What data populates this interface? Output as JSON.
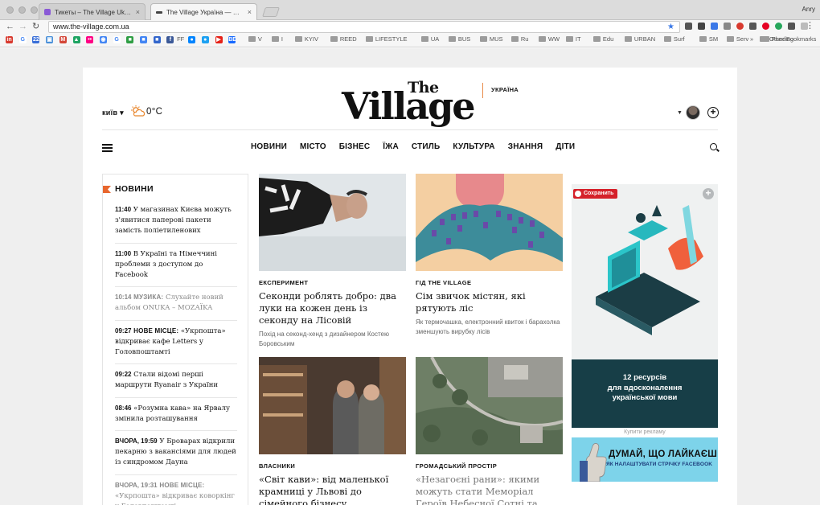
{
  "browser": {
    "tabs": [
      {
        "label": "Тикеты – The Village Ukraine",
        "active": false
      },
      {
        "label": "The Village Україна — Новини",
        "active": true
      }
    ],
    "user_name": "Anry",
    "url": "www.the-village.com.ua",
    "bookmark_folders": [
      "V",
      "I",
      "KYIV",
      "REED",
      "LIFESTYLE",
      "UA",
      "BUS",
      "MUS",
      "Ru",
      "WW",
      "IT",
      "Edu",
      "URBAN",
      "Surf",
      "SM",
      "Serv",
      "Funding"
    ],
    "other_bookmarks": "Other Bookmarks",
    "bookmark_icons": [
      {
        "text": "in",
        "color": "#d83a2f"
      },
      {
        "text": "G",
        "color": "#ffffff"
      },
      {
        "text": "22",
        "color": "#3a6fd8"
      },
      {
        "text": "▣",
        "color": "#4a90d9"
      },
      {
        "text": "M",
        "color": "#d44638"
      },
      {
        "text": "▲",
        "color": "#1fa463"
      },
      {
        "text": "••",
        "color": "#ff0084"
      },
      {
        "text": "◉",
        "color": "#4285f4"
      },
      {
        "text": "G",
        "color": "#ffffff"
      },
      {
        "text": "■",
        "color": "#2f9e44"
      },
      {
        "text": "■",
        "color": "#4285f4"
      },
      {
        "text": "■",
        "color": "#3366cc"
      },
      {
        "text": "f",
        "color": "#3b5998"
      }
    ],
    "bookmark_ff": "FF",
    "bookmark_icons2": [
      {
        "text": "●",
        "color": "#0084ff"
      },
      {
        "text": "●",
        "color": "#1da1f2"
      },
      {
        "text": "▶",
        "color": "#e62117"
      },
      {
        "text": "BЕ",
        "color": "#1769ff"
      }
    ],
    "extension_colors": [
      "#555555",
      "#444444",
      "#3b78e7",
      "#888888",
      "#d83a2f",
      "#555555",
      "#e60023",
      "#26a65b",
      "#555555",
      "#bbbbbb"
    ]
  },
  "site": {
    "city": "київ",
    "temperature": "0°C",
    "logo_the": "The",
    "logo_main": "Village",
    "region": "УКРАЇНА",
    "nav": [
      "НОВИНИ",
      "МІСТО",
      "БІЗНЕС",
      "ЇЖА",
      "СТИЛЬ",
      "КУЛЬТУРА",
      "ЗНАННЯ",
      "ДІТИ"
    ],
    "accent_color": "#e8662d"
  },
  "news": {
    "title": "НОВИНИ",
    "items": [
      {
        "time": "11:40",
        "tag": "",
        "text": "У магазинах Києва можуть з'явитися паперові пакети замість поліетиленових",
        "dim": false
      },
      {
        "time": "11:00",
        "tag": "",
        "text": "В Україні та Німеччині проблеми з доступом до Facebook",
        "dim": false
      },
      {
        "time": "10:14",
        "tag": "МУЗИКА:",
        "text": "Слухайте новий альбом ONUKA – MOZAЇKA",
        "dim": true
      },
      {
        "time": "09:27",
        "tag": "НОВЕ МІСЦЕ:",
        "text": "«Укрпошта» відкриває кафе Letters у Головпоштамті",
        "dim": false
      },
      {
        "time": "09:22",
        "tag": "",
        "text": "Стали відомі перші маршрути Ryanair з України",
        "dim": false
      },
      {
        "time": "08:46",
        "tag": "",
        "text": "«Розумна кава» на Ярвалу змінила розташування",
        "dim": false
      },
      {
        "time": "ВЧОРА, 19:59",
        "tag": "",
        "text": "У Броварах відкрили пекарню з вакансіями для людей із синдромом Дауна",
        "dim": false
      },
      {
        "time": "ВЧОРА, 19:31",
        "tag": "НОВЕ МІСЦЕ:",
        "text": "«Укрпошта» відкриває коворкінг у Головпоштамті",
        "dim": true
      }
    ]
  },
  "articles": [
    {
      "rubric": "ЕКСПЕРИМЕНТ",
      "headline": "Секонди роблять добро: два луки на кожен день із секонду на Лісовій",
      "lead": "Похід на секонд-хенд з дизайнером Костею Боровським",
      "muted": false
    },
    {
      "rubric": "ГІД THE VILLAGE",
      "headline": "Сім звичок містян, які рятують ліс",
      "lead": "Як термочашка, електронний квиток і барахолка зменшують вирубку лісів",
      "muted": false
    },
    {
      "rubric": "ВЛАСНИКИ",
      "headline": "«Світ кави»: від маленької крамниці у Львові до сімейного бізнесу",
      "lead": "",
      "muted": false
    },
    {
      "rubric": "ГРОМАДСЬКИЙ ПРОСТІР",
      "headline": "«Незагоєні рани»: якими можуть стати Меморіал Героїв Небесної Сотні та Музей Революції Гідності",
      "lead": "",
      "muted": true
    }
  ],
  "ad": {
    "save_label": "Сохранить",
    "expand_icon": "+",
    "text_line1": "12 ресурсів",
    "text_line2": "для вдосконалення",
    "text_line3": "української мови",
    "buy_label": "Купити рекламу",
    "banner_title": "ДУМАЙ, ЩО ЛАЙКАЄШ",
    "banner_sub": "ЯК НАЛАШТУВАТИ СТРІЧКУ FACEBOOK"
  }
}
